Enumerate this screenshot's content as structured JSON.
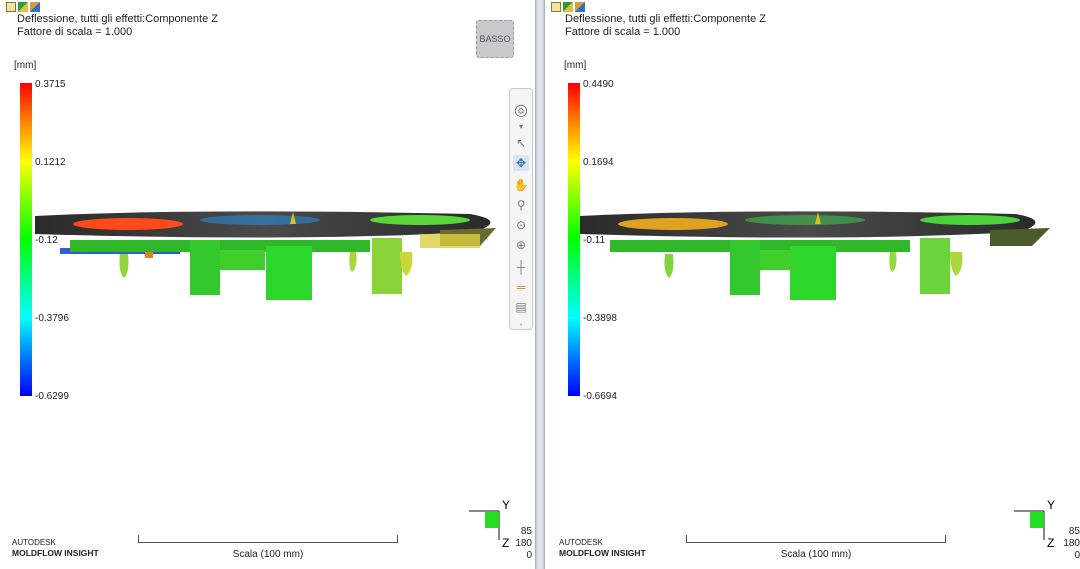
{
  "panes": [
    {
      "title_line1": "Deflessione, tutti gli effetti:Componente Z",
      "title_line2": "Fattore di scala = 1.000",
      "unit": "[mm]",
      "ticks": [
        "0.3715",
        "0.1212",
        "-0.12",
        "-0.3796",
        "-0.6299"
      ],
      "view_cube_label": "BASSO",
      "brand_line1": "AUTODESK",
      "brand_line2": "MOLDFLOW",
      "brand_line3": "INSIGHT",
      "scale_label": "Scala (100 mm)",
      "axis_y": "Y",
      "axis_z": "Z",
      "axis_vals": [
        "85",
        "180",
        "0"
      ]
    },
    {
      "title_line1": "Deflessione, tutti gli effetti:Componente Z",
      "title_line2": "Fattore di scala = 1.000",
      "unit": "[mm]",
      "ticks": [
        "0.4490",
        "0.1694",
        "-0.11",
        "-0.3898",
        "-0.6694"
      ],
      "brand_line1": "AUTODESK",
      "brand_line2": "MOLDFLOW",
      "brand_line3": "INSIGHT",
      "scale_label": "Scala (100 mm)",
      "axis_y": "Y",
      "axis_z": "Z",
      "axis_vals": [
        "85",
        "180",
        "0"
      ]
    }
  ],
  "toolbar_icons": [
    "view-cube-icon",
    "dropdown-icon",
    "select-icon",
    "rotate-icon",
    "pan-icon",
    "zoom-icon",
    "zoom-window-icon",
    "fit-icon",
    "center-icon",
    "clip-plane-icon",
    "layer-icon",
    "expand-icon"
  ],
  "colors": {
    "scale_top": "#ff0000",
    "scale_mid": "#00ff00",
    "scale_bottom": "#0000ff"
  }
}
